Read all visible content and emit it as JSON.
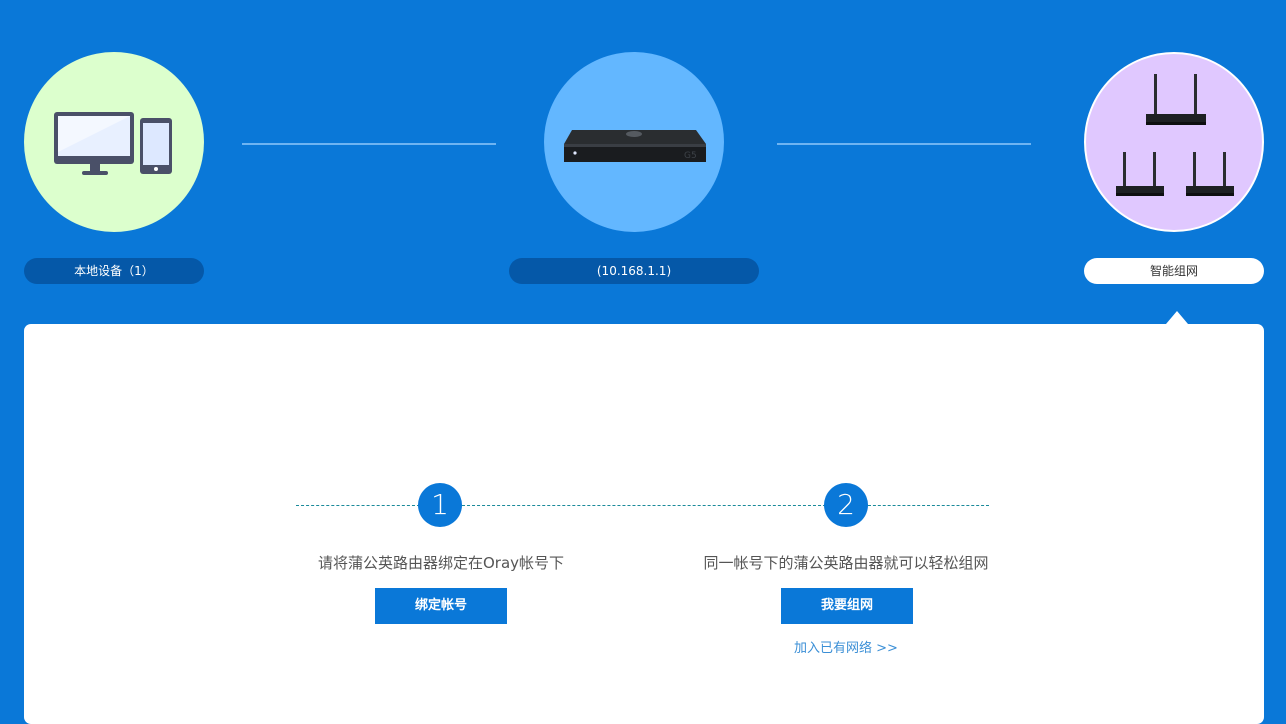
{
  "topology": {
    "local_devices": {
      "icon": "computer-and-tablet-icon",
      "label": "本地设备（1）",
      "circle_color": "#dcffcd"
    },
    "router": {
      "icon": "router-g5-icon",
      "label": "(10.168.1.1)",
      "model_text": "G5",
      "circle_color": "#63b7ff"
    },
    "mesh": {
      "icon": "mesh-routers-icon",
      "label": "智能组网",
      "circle_color": "#e0c8ff"
    }
  },
  "steps": [
    {
      "number": "1",
      "description": "请将蒲公英路由器绑定在Oray帐号下",
      "button_label": "绑定帐号"
    },
    {
      "number": "2",
      "description": "同一帐号下的蒲公英路由器就可以轻松组网",
      "button_label": "我要组网",
      "link_label": "加入已有网络 >>"
    }
  ],
  "colors": {
    "background": "#0a78d8",
    "pill": "#0558a8",
    "accent": "#0a78d8",
    "link": "#3b8fd6"
  }
}
